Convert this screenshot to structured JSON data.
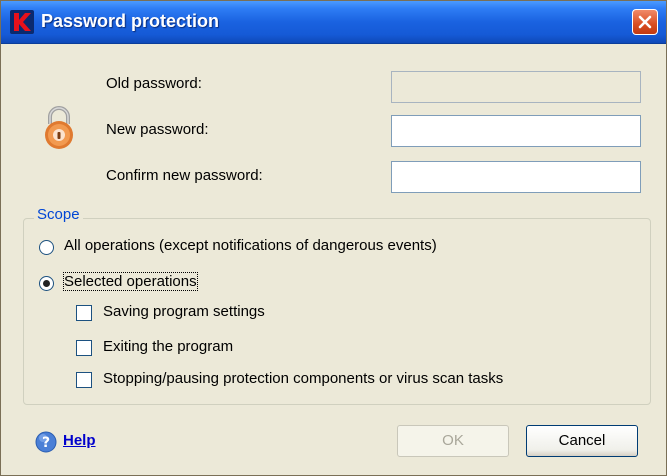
{
  "window": {
    "title": "Password protection"
  },
  "passwords": {
    "old_label": "Old password:",
    "new_label": "New password:",
    "confirm_label": "Confirm new password:"
  },
  "scope": {
    "legend": "Scope",
    "option_all": "All operations (except notifications of dangerous events)",
    "option_selected": "Selected operations",
    "selected_option": "Selected operations",
    "checkboxes": [
      {
        "label": "Saving program settings",
        "checked": false
      },
      {
        "label": "Exiting the program",
        "checked": false
      },
      {
        "label": "Stopping/pausing protection components or virus scan tasks",
        "checked": false
      }
    ]
  },
  "footer": {
    "help_label": "Help",
    "ok_label": "OK",
    "cancel_label": "Cancel"
  },
  "icons": {
    "app": "kaspersky-k-icon",
    "close": "close-icon",
    "lock": "padlock-icon",
    "help": "question-mark-icon"
  },
  "colors": {
    "titlebar": "#1a62e0",
    "close": "#d94d22",
    "scope_legend": "#0046d5",
    "help_link": "#0000cc",
    "lock": "#e07a30"
  }
}
